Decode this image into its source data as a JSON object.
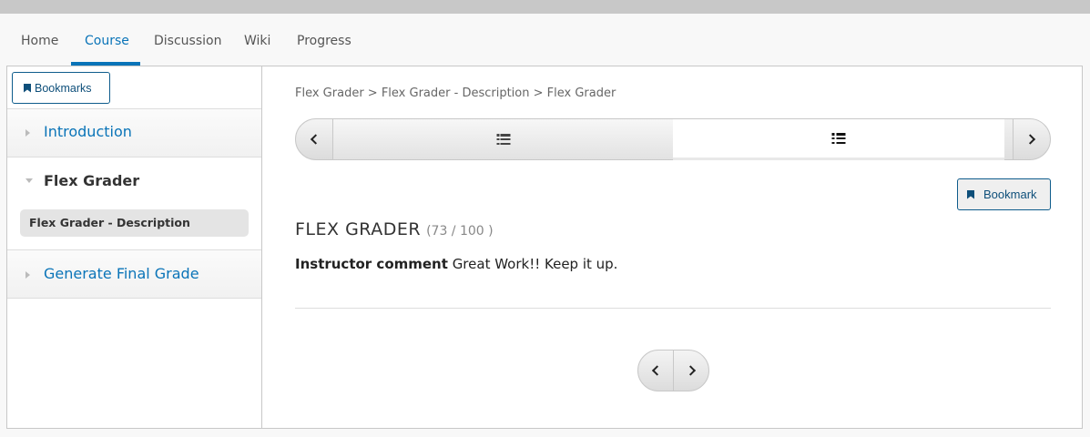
{
  "nav": {
    "items": [
      {
        "label": "Home",
        "active": false
      },
      {
        "label": "Course",
        "active": true
      },
      {
        "label": "Discussion",
        "active": false
      },
      {
        "label": "Wiki",
        "active": false
      },
      {
        "label": "Progress",
        "active": false
      }
    ]
  },
  "colors": {
    "accent": "#0a74b8",
    "bookmark_border": "#0e5c8c"
  },
  "sidebar": {
    "bookmarks_label": "Bookmarks",
    "sections": [
      {
        "title": "Introduction",
        "expanded": false
      },
      {
        "title": "Flex Grader",
        "expanded": true,
        "subsections": [
          {
            "title": "Flex Grader - Description",
            "active": true
          }
        ]
      },
      {
        "title": "Generate Final Grade",
        "expanded": false
      }
    ]
  },
  "main": {
    "breadcrumb": "Flex Grader > Flex Grader - Description > Flex Grader",
    "sequence": {
      "tab_icons": [
        "list-icon",
        "list-icon"
      ],
      "active_tab": 1
    },
    "bookmark_label": "Bookmark",
    "unit_title": "FLEX GRADER",
    "score": "(73 / 100 )",
    "comment_label": "Instructor comment",
    "comment_text": "Great Work!! Keep it up."
  }
}
